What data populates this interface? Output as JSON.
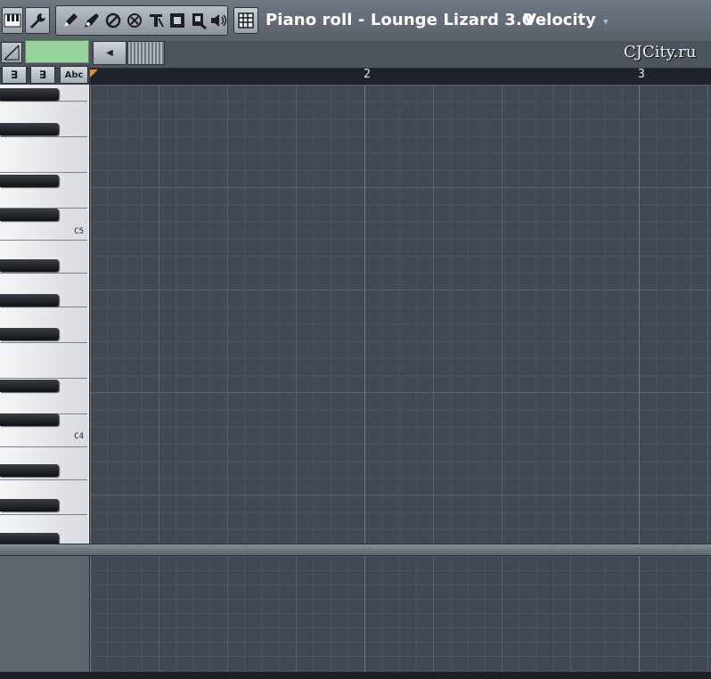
{
  "window": {
    "title": "Piano roll - Lounge Lizard 3.0",
    "title_caret": "▾",
    "target": "Velocity",
    "target_caret": "▾"
  },
  "toolbar": {
    "piano_icon": "piano-keys-icon",
    "wrench_icon": "wrench-icon",
    "tools": [
      {
        "name": "draw-tool-icon",
        "glyph": "✎"
      },
      {
        "name": "paint-tool-icon",
        "glyph": "🖌"
      },
      {
        "name": "delete-tool-icon",
        "glyph": "⊘"
      },
      {
        "name": "mute-tool-icon",
        "glyph": "⊗"
      },
      {
        "name": "slice-tool-icon",
        "glyph": "⊤"
      },
      {
        "name": "select-tool-icon",
        "glyph": "▣"
      },
      {
        "name": "zoom-tool-icon",
        "glyph": "🔍"
      },
      {
        "name": "speaker-tool-icon",
        "glyph": "🔈"
      }
    ],
    "grid_icon": "snap-grid-icon"
  },
  "bar2": {
    "watermark": "CJCity.ru",
    "scroll_left_glyph": "◀"
  },
  "bar3": {
    "btn1": "∃",
    "btn2": "∃",
    "btn3": "Abc"
  },
  "timeline": {
    "markers": [
      "2",
      "3"
    ]
  },
  "keyboard": {
    "labels": [
      "C5",
      "C4"
    ]
  },
  "colors": {
    "grid_bg": "#424955",
    "accent_green": "#97d39a",
    "playhead": "#e88a2e"
  }
}
